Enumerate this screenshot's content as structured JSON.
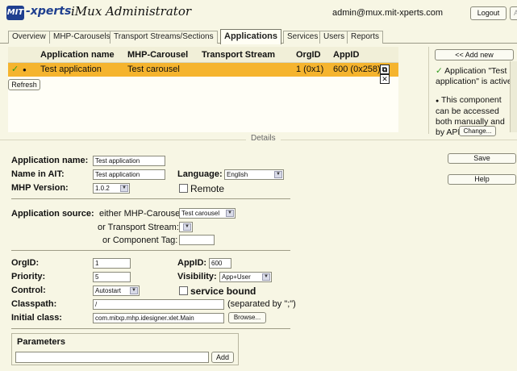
{
  "header": {
    "logo_text": "MIT",
    "brand": "-xperts",
    "app_title": "iMux Administrator",
    "user": "admin@mux.mit-xperts.com",
    "logout": "Logout",
    "activate": "Activate"
  },
  "tabs": [
    {
      "label": "Overview"
    },
    {
      "label": "MHP-Carousels"
    },
    {
      "label": "Transport Streams/Sections"
    },
    {
      "label": "Applications"
    },
    {
      "label": "Services"
    },
    {
      "label": "Users"
    },
    {
      "label": "Reports"
    }
  ],
  "grid": {
    "headers": [
      "Application name",
      "MHP-Carousel",
      "Transport Stream",
      "OrgID",
      "AppID"
    ],
    "row": {
      "name": "Test application",
      "carousel": "Test carousel",
      "transport_stream": "",
      "org_id": "1 (0x1)",
      "app_id": "600 (0x258)"
    },
    "refresh": "Refresh"
  },
  "side": {
    "add_new": "<< Add new",
    "status_lines": [
      "Application \"Test",
      "application\" is active."
    ],
    "component_lines": [
      "This component",
      "can be accessed",
      "both manually and",
      "by API."
    ],
    "change": "Change..."
  },
  "details": {
    "section_label": "Details",
    "app_name_label": "Application name:",
    "app_name_value": "Test application",
    "ait_label": "Name in AIT:",
    "ait_value": "Test application",
    "language_label": "Language:",
    "language_value": "English",
    "mhp_label": "MHP Version:",
    "mhp_value": "1.0.2",
    "remote_label": "Remote",
    "source_label": "Application source:",
    "carousel_label": "either MHP-Carousel:",
    "carousel_value": "Test carousel",
    "ts_label": "or Transport Stream:",
    "tag_label": "or Component Tag:",
    "orgid_label": "OrgID:",
    "orgid_value": "1",
    "appid_label": "AppID:",
    "appid_value": "600",
    "priority_label": "Priority:",
    "priority_value": "5",
    "visibility_label": "Visibility:",
    "visibility_value": "App+User",
    "control_label": "Control:",
    "control_value": "Autostart",
    "service_bound_label": "service bound",
    "classpath_label": "Classpath:",
    "classpath_value": "/",
    "classpath_hint": "(separated by \";\")",
    "initial_class_label": "Initial class:",
    "initial_class_value": "com.mitxp.mhp.idesigner.xlet.Main",
    "browse": "Browse...",
    "parameters_label": "Parameters",
    "add": "Add",
    "save": "Save",
    "help": "Help"
  },
  "colors": {
    "background": "#f7f6e4",
    "selected_row": "#f5b42e",
    "brand_blue": "#1f3f8f",
    "check_green": "#2e9a1c"
  }
}
